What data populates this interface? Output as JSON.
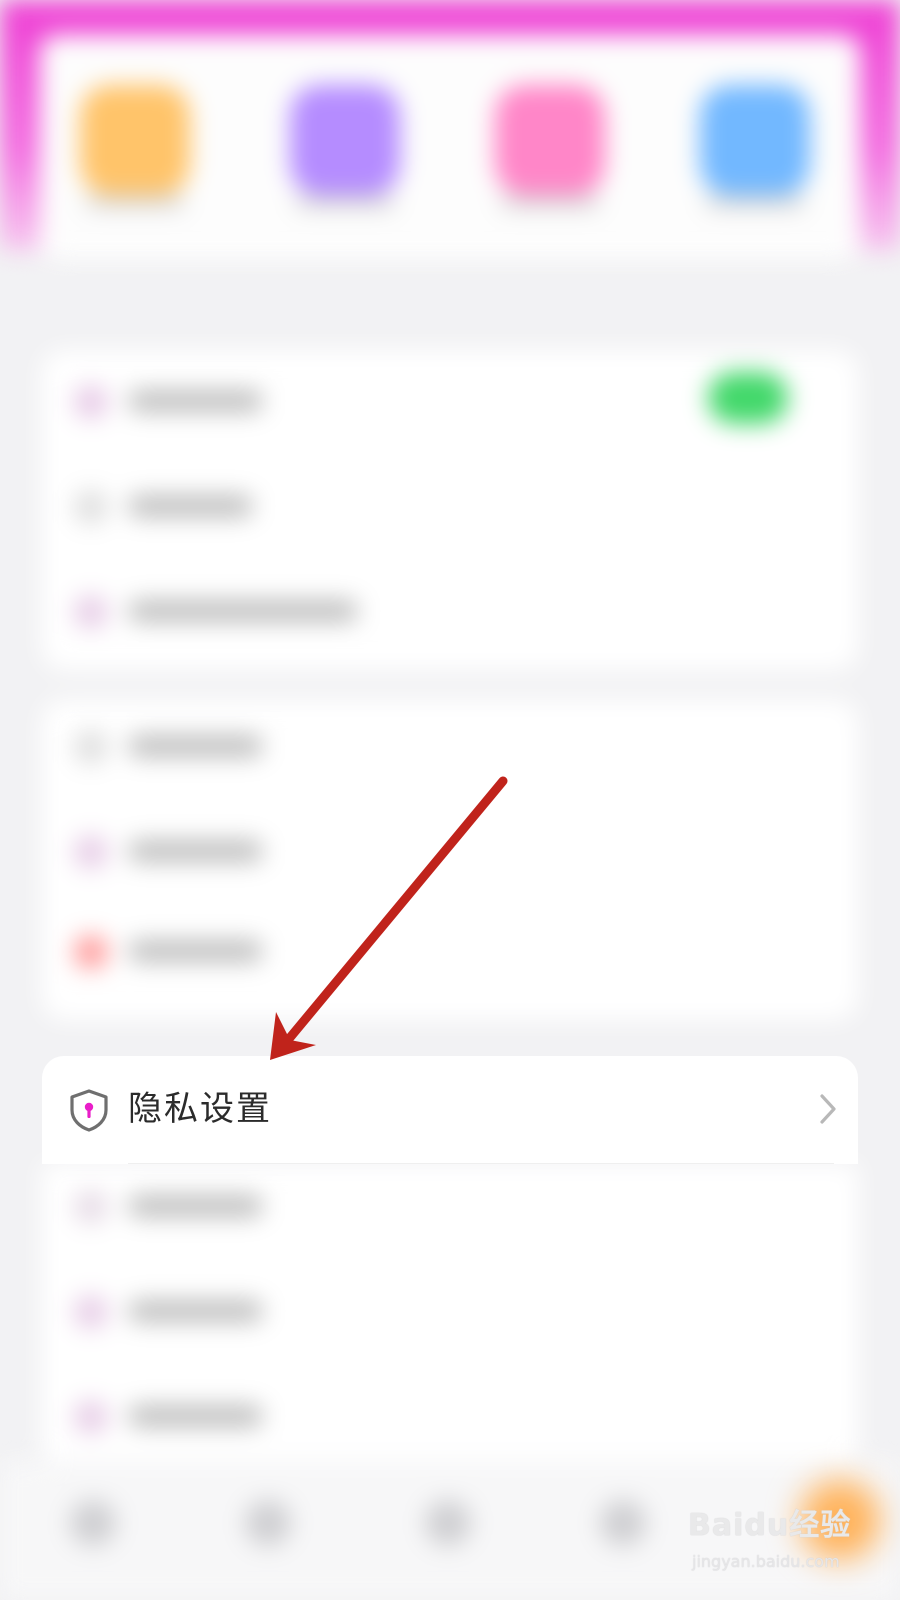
{
  "privacy_row": {
    "label": "隐私设置",
    "icon": "shield-keyhole-icon",
    "chevron": "chevron-right-icon",
    "icon_accent_color": "#e91ec9"
  },
  "annotation": {
    "arrow_color": "#c0231b"
  },
  "watermark": {
    "logo": "Baidu经验",
    "url": "jingyan.baidu.com"
  },
  "colors": {
    "banner": "#ee3fd4",
    "toggle_on": "#42d86a"
  }
}
